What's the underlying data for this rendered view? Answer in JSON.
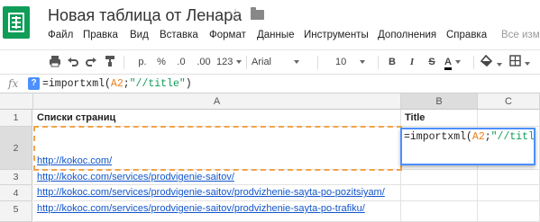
{
  "header": {
    "title": "Новая таблица от Ленара",
    "star_icon": "star-outline-icon",
    "folder_icon": "folder-icon"
  },
  "menu": {
    "items": [
      "Файл",
      "Правка",
      "Вид",
      "Вставка",
      "Формат",
      "Данные",
      "Инструменты",
      "Дополнения",
      "Справка"
    ],
    "edit_hint": "Все изм"
  },
  "toolbar": {
    "currency": "р.",
    "percent": "%",
    "decrease_decimals": ".0",
    "increase_decimals": ".00",
    "number_format": "123",
    "font": "Arial",
    "font_size": "10",
    "bold": "B",
    "italic": "I",
    "strikethrough": "S",
    "text_color": "A"
  },
  "formula_bar": {
    "fx": "fx",
    "help": "?",
    "formula_prefix": "=importxml(",
    "formula_ref": "A2",
    "formula_sep": ";",
    "formula_string": "\"//title\"",
    "formula_suffix": ")"
  },
  "grid": {
    "columns": [
      "A",
      "B",
      "C"
    ],
    "rows": [
      "1",
      "2",
      "3",
      "4",
      "5"
    ],
    "a1": "Списки страниц",
    "b1": "Title",
    "links": [
      "http://kokoc.com/",
      "http://kokoc.com/services/prodvigenie-saitov/",
      "http://kokoc.com/services/prodvigenie-saitov/prodvizhenie-sayta-po-pozitsiyam/",
      "http://kokoc.com/services/prodvigenie-saitov/prodvizhenie-sayta-po-trafiku/"
    ]
  },
  "colors": {
    "logo": "#0f9d58",
    "link": "#1155cc",
    "copy_border": "#f0a44a",
    "edit_border": "#4d90fe"
  }
}
